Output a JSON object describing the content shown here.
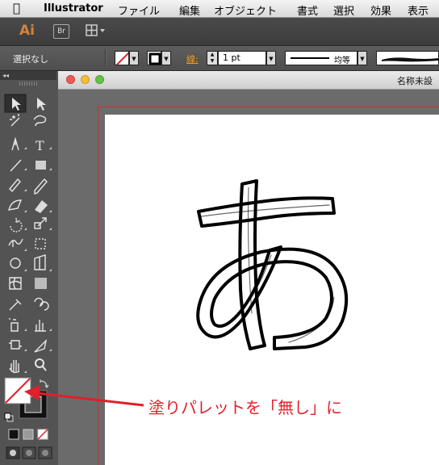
{
  "menubar": {
    "app_name": "Illustrator",
    "items": [
      "ファイル",
      "編集",
      "オブジェクト",
      "書式",
      "選択",
      "効果",
      "表示"
    ]
  },
  "appbar": {
    "logo": "Ai",
    "bridge": "Br"
  },
  "control_bar": {
    "selection_status": "選択なし",
    "stroke_label": "線:",
    "stroke_weight": "1 pt",
    "profile_label": "均等"
  },
  "document": {
    "title": "名称未設"
  },
  "canvas": {
    "glyph": "あ"
  },
  "annotation": {
    "text": "塗りパレットを「無し」に"
  },
  "colors": {
    "accent_red": "#e0202a",
    "artboard_border": "#c8302c",
    "ai_logo": "#d4823a"
  }
}
